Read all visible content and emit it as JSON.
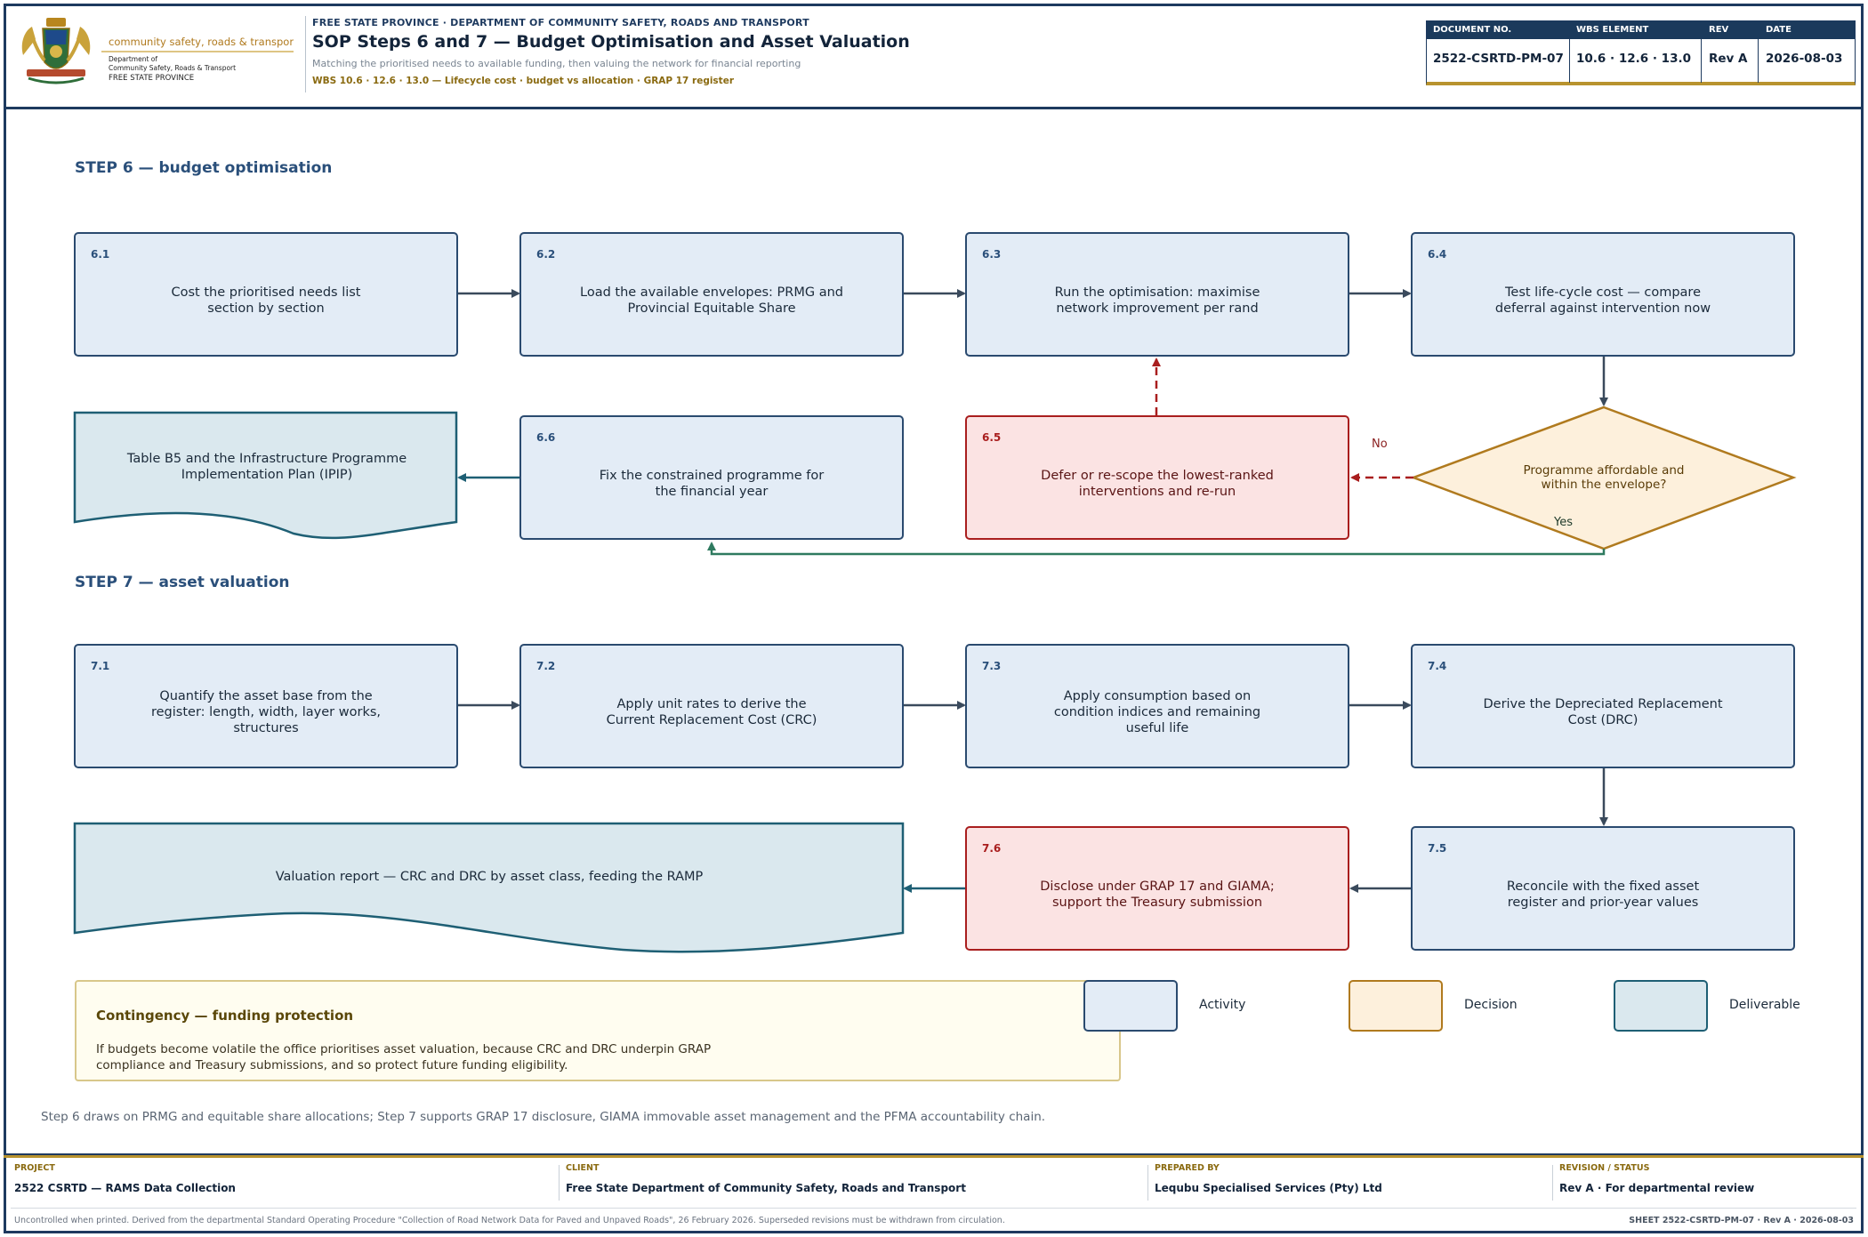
{
  "header": {
    "logo": {
      "text1": "community safety, roads & transport",
      "text2": "Department of",
      "text3": "Community Safety, Roads & Transport",
      "text4": "FREE STATE PROVINCE"
    },
    "kicker": "FREE STATE PROVINCE · DEPARTMENT OF COMMUNITY SAFETY, ROADS AND TRANSPORT",
    "title": "SOP Steps 6 and 7 — Budget Optimisation and Asset Valuation",
    "subtitle": "Matching the prioritised needs to available funding, then valuing the network for financial reporting",
    "wbs_line": "WBS 10.6 · 12.6 · 13.0 — Lifecycle cost · budget vs allocation · GRAP 17 register",
    "doc_table": {
      "headers": [
        "DOCUMENT NO.",
        "WBS ELEMENT",
        "REV",
        "DATE"
      ],
      "values": [
        "2522-CSRTD-PM-07",
        "10.6 · 12.6 · 13.0",
        "Rev A",
        "2026-08-03"
      ]
    }
  },
  "colors": {
    "navy": "#1e3a5f",
    "activity_fill": "#e3ecf6",
    "activity_stroke": "#2a4a6f",
    "red_fill": "#fbe3e3",
    "red_stroke": "#a91e1e",
    "decision_fill": "#fdf0dc",
    "decision_stroke": "#b07a1e",
    "deliverable_fill": "#dae8ee",
    "deliverable_stroke": "#1e5f74",
    "gold": "#b8932e",
    "green_flow": "#2e7a5f"
  },
  "step6": {
    "label": "STEP 6 — budget optimisation",
    "nodes": {
      "n61": {
        "num": "6.1",
        "text": "Cost the prioritised needs list section by section"
      },
      "n62": {
        "num": "6.2",
        "text": "Load the available envelopes: PRMG and Provincial Equitable Share"
      },
      "n63": {
        "num": "6.3",
        "text": "Run the optimisation: maximise network improvement per rand"
      },
      "n64": {
        "num": "6.4",
        "text": "Test life-cycle cost — compare deferral against intervention now"
      },
      "n65": {
        "num": "6.5",
        "text": "Defer or re-scope the lowest-ranked interventions and re-run"
      },
      "n66": {
        "num": "6.6",
        "text": "Fix the constrained programme for the financial year"
      },
      "decision": {
        "text": "Programme affordable and within the envelope?",
        "no": "No",
        "yes": "Yes"
      },
      "deliverable": {
        "text": "Table B5 and the Infrastructure Programme Implementation Plan (IPIP)"
      }
    }
  },
  "step7": {
    "label": "STEP 7 — asset valuation",
    "nodes": {
      "n71": {
        "num": "7.1",
        "text": "Quantify the asset base from the register: length, width, layer works, structures"
      },
      "n72": {
        "num": "7.2",
        "text": "Apply unit rates to derive the Current Replacement Cost (CRC)"
      },
      "n73": {
        "num": "7.3",
        "text": "Apply consumption based on condition indices and remaining useful life"
      },
      "n74": {
        "num": "7.4",
        "text": "Derive the Depreciated Replacement Cost (DRC)"
      },
      "n75": {
        "num": "7.5",
        "text": "Reconcile with the fixed asset register and prior-year values"
      },
      "n76": {
        "num": "7.6",
        "text": "Disclose under GRAP 17 and GIAMA; support the Treasury submission"
      },
      "deliverable": {
        "text": "Valuation report — CRC and DRC by asset class, feeding the RAMP"
      }
    }
  },
  "contingency": {
    "title": "Contingency — funding protection",
    "body": "If budgets become volatile the office prioritises asset valuation, because CRC and DRC underpin GRAP compliance and Treasury submissions, and so protect future funding eligibility."
  },
  "legend": {
    "activity": "Activity",
    "decision": "Decision",
    "deliverable": "Deliverable"
  },
  "note": "Step 6 draws on PRMG and equitable share allocations; Step 7 supports GRAP 17 disclosure, GIAMA immovable asset management and the PFMA accountability chain.",
  "footer": {
    "project": {
      "label": "PROJECT",
      "value": "2522 CSRTD — RAMS Data Collection"
    },
    "client": {
      "label": "CLIENT",
      "value": "Free State Department of Community Safety, Roads and Transport"
    },
    "prepared": {
      "label": "PREPARED BY",
      "value": "Lequbu Specialised Services (Pty) Ltd"
    },
    "revision": {
      "label": "REVISION / STATUS",
      "value": "Rev A · For departmental review"
    },
    "disclaimer": "Uncontrolled when printed. Derived from the departmental Standard Operating Procedure \"Collection of Road Network Data for Paved and Unpaved Roads\", 26 February 2026. Superseded revisions must be withdrawn from circulation.",
    "sheet": "SHEET 2522-CSRTD-PM-07 · Rev A · 2026-08-03"
  }
}
